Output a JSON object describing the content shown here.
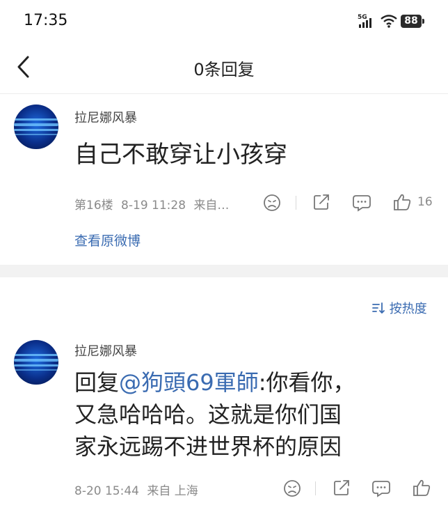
{
  "status_bar": {
    "time": "17:35",
    "network": "5G",
    "battery": "88"
  },
  "header": {
    "title": "0条回复"
  },
  "original_comment": {
    "username": "拉尼娜风暴",
    "text": "自己不敢穿让小孩穿",
    "floor": "第16楼",
    "datetime": "8-19 11:28",
    "source": "来自…",
    "like_count": "16",
    "view_original": "查看原微博"
  },
  "sort": {
    "label": "按热度"
  },
  "reply": {
    "username": "拉尼娜风暴",
    "prefix": "回复",
    "mention": "@狗頭69軍師",
    "line1_rest": ":你看你，",
    "line2": "又急哈哈哈。这就是你们国",
    "line3": "家永远踢不进世界杯的原因",
    "datetime": "8-20 15:44",
    "source": "来自 上海"
  }
}
